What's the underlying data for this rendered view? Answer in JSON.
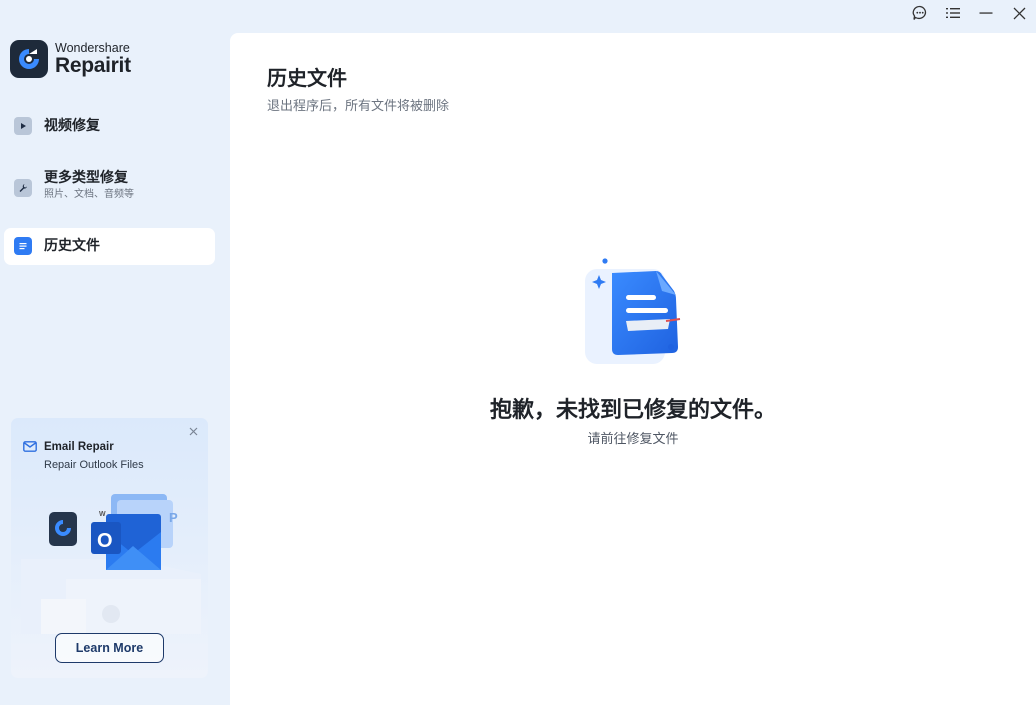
{
  "app": {
    "brand": "Wondershare",
    "product": "Repairit"
  },
  "window_controls": {
    "feedback_icon": "chat-bubble-icon",
    "menu_icon": "menu-list-icon",
    "minimize_icon": "minimize-icon",
    "close_icon": "close-icon"
  },
  "sidebar": {
    "items": [
      {
        "label": "视频修复",
        "sub": "",
        "icon": "video-play-icon",
        "active": false
      },
      {
        "label": "更多类型修复",
        "sub": "照片、文档、音频等",
        "icon": "wrench-icon",
        "active": false
      },
      {
        "label": "历史文件",
        "sub": "",
        "icon": "document-icon",
        "active": true
      }
    ]
  },
  "promo": {
    "title": "Email Repair",
    "subtitle": "Repair Outlook Files",
    "button": "Learn More",
    "icons": [
      "mail-icon",
      "close-icon"
    ],
    "art_letters": {
      "w": "W",
      "o": "O",
      "p": "P"
    }
  },
  "main": {
    "title": "历史文件",
    "subtitle": "退出程序后，所有文件将被删除",
    "empty_title": "抱歉，未找到已修复的文件。",
    "empty_subtitle": "请前往修复文件"
  },
  "colors": {
    "accent": "#2f7bf3",
    "sidebar_bg": "#e9f1fb",
    "panel_bg": "#ffffff",
    "text_primary": "#1f2329",
    "text_secondary": "#6c7480"
  }
}
